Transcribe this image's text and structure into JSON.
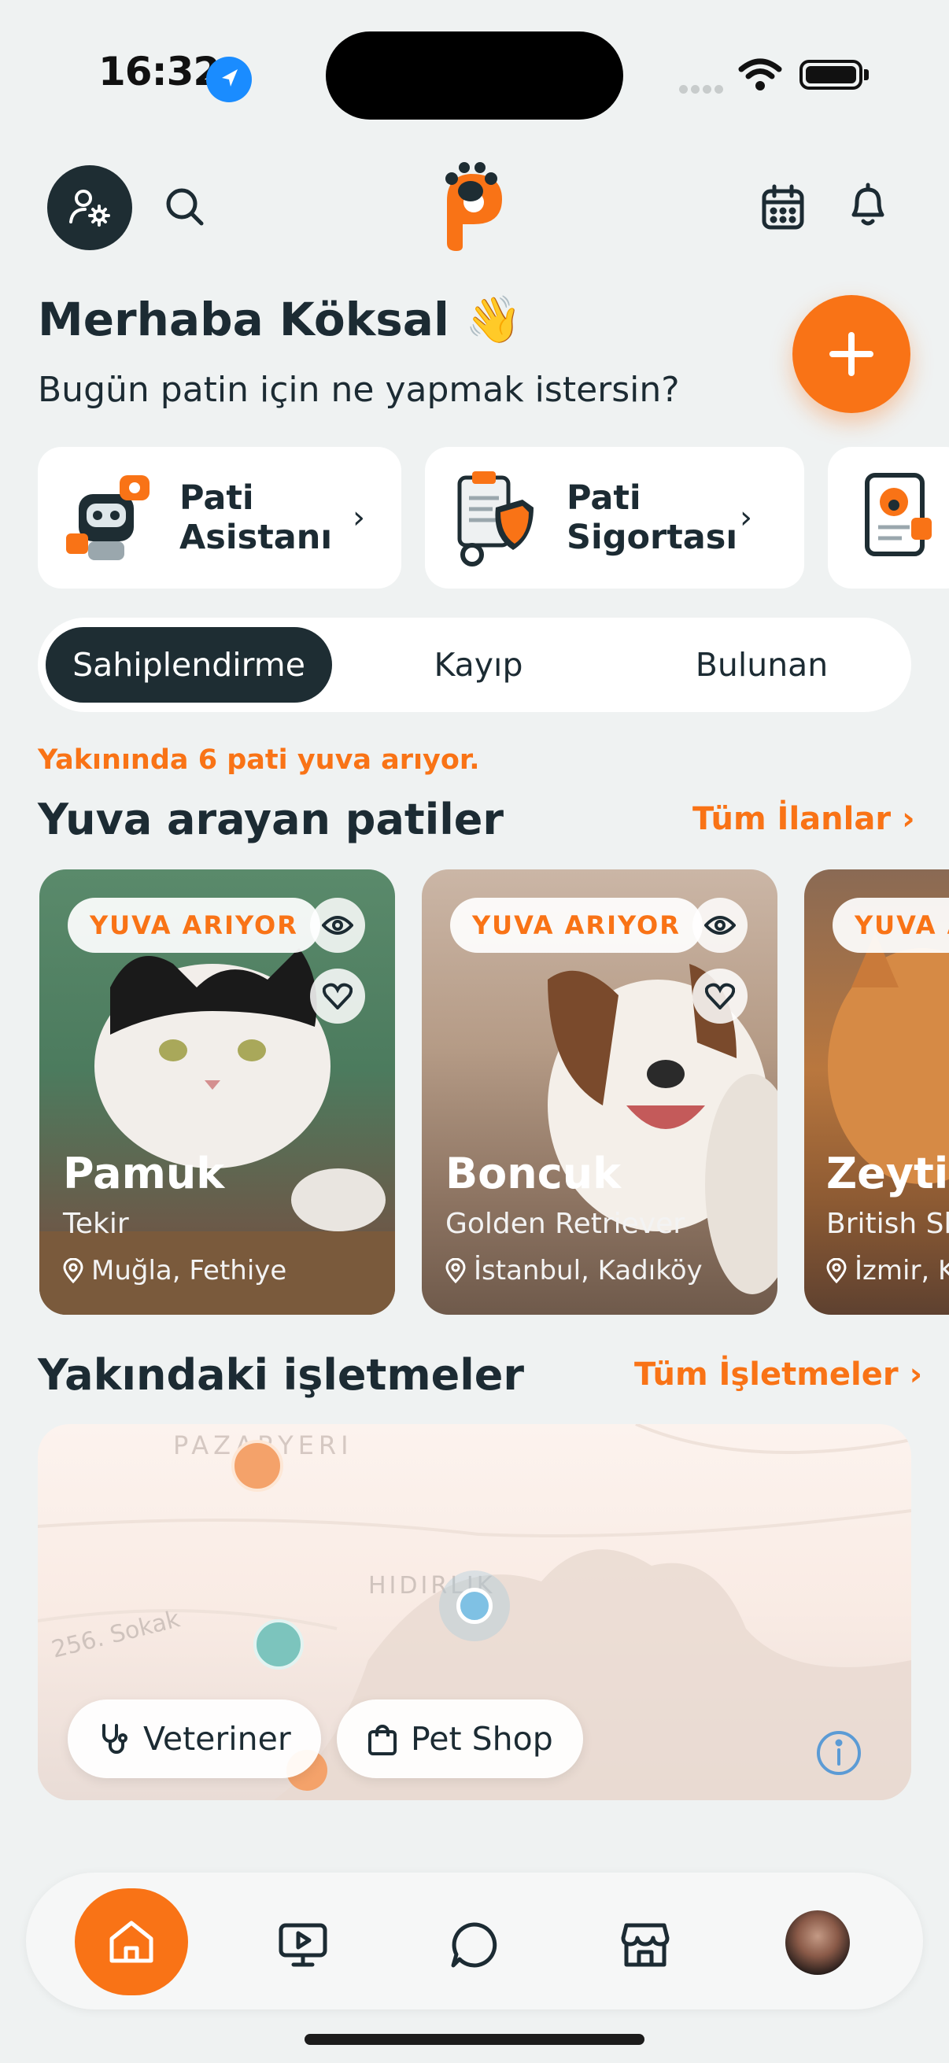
{
  "status_bar": {
    "time": "16:32"
  },
  "header": {
    "profile_icon": "profile-settings-icon",
    "search_icon": "search-icon",
    "logo_icon": "paw-p-logo",
    "calendar_icon": "calendar-icon",
    "bell_icon": "bell-icon",
    "add_icon": "plus-icon"
  },
  "greeting": {
    "title": "Merhaba Köksal 👋",
    "subtitle": "Bugün patin için ne yapmak istersin?"
  },
  "quick_actions": [
    {
      "line1": "Pati",
      "line2": "Asistanı",
      "icon": "robot-assistant-icon"
    },
    {
      "line1": "Pati",
      "line2": "Sigortası",
      "icon": "insurance-shield-icon"
    },
    {
      "line1": "",
      "line2": "",
      "icon": "pet-passport-icon"
    }
  ],
  "tabs": [
    {
      "label": "Sahiplendirme",
      "active": true
    },
    {
      "label": "Kayıp",
      "active": false
    },
    {
      "label": "Bulunan",
      "active": false
    }
  ],
  "adoption": {
    "note": "Yakınında 6 pati yuva arıyor.",
    "title": "Yuva arayan patiler",
    "link": "Tüm İlanlar",
    "pets": [
      {
        "badge": "YUVA ARIYOR",
        "name": "Pamuk",
        "breed": "Tekir",
        "location": "Muğla, Fethiye"
      },
      {
        "badge": "YUVA ARIYOR",
        "name": "Boncuk",
        "breed": "Golden Retriever",
        "location": "İstanbul, Kadıköy"
      },
      {
        "badge": "YUVA ARIYOR",
        "name": "Zeytin",
        "breed": "British Sh",
        "location": "İzmir, K"
      }
    ]
  },
  "nearby": {
    "title": "Yakındaki işletmeler",
    "link": "Tüm İşletmeler",
    "map_labels": {
      "district1": "PAZARYERI",
      "district2": "HIDIRLIK",
      "street": "256. Sokak"
    },
    "chips": [
      {
        "label": "Veteriner",
        "icon": "stethoscope-icon"
      },
      {
        "label": "Pet Shop",
        "icon": "shopping-bag-icon"
      }
    ]
  },
  "bottom_nav": [
    "home-icon",
    "video-icon",
    "chat-icon",
    "store-icon",
    "avatar"
  ],
  "colors": {
    "accent": "#f97316",
    "dark": "#1e2d33",
    "background": "#eff2f2"
  }
}
